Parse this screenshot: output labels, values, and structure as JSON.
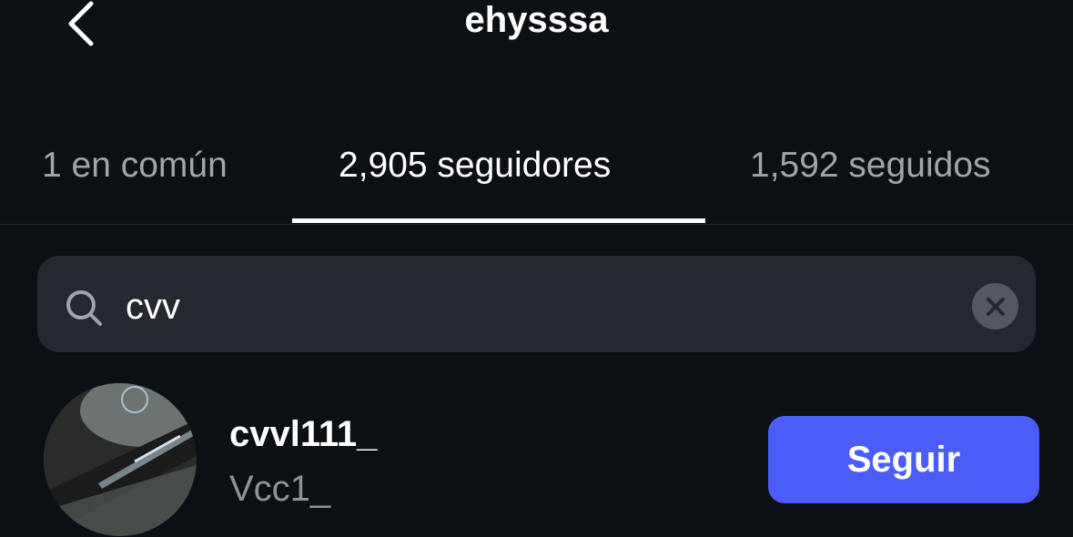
{
  "header": {
    "title": "ehysssa",
    "back_icon": "chevron-left-icon"
  },
  "tabs": [
    {
      "label": "1 en común",
      "active": false
    },
    {
      "label": "2,905 seguidores",
      "active": true
    },
    {
      "label": "1,592 seguidos",
      "active": false
    }
  ],
  "search": {
    "value": "cvv",
    "icon": "search-icon",
    "clear_icon": "close-icon"
  },
  "results": [
    {
      "username": "cvvl111_",
      "full_name": "Vcc1_",
      "button_label": "Seguir"
    }
  ],
  "colors": {
    "background": "#0c0f14",
    "accent": "#4a5df9",
    "search_bg": "#25282e",
    "muted_text": "#8e9299"
  }
}
